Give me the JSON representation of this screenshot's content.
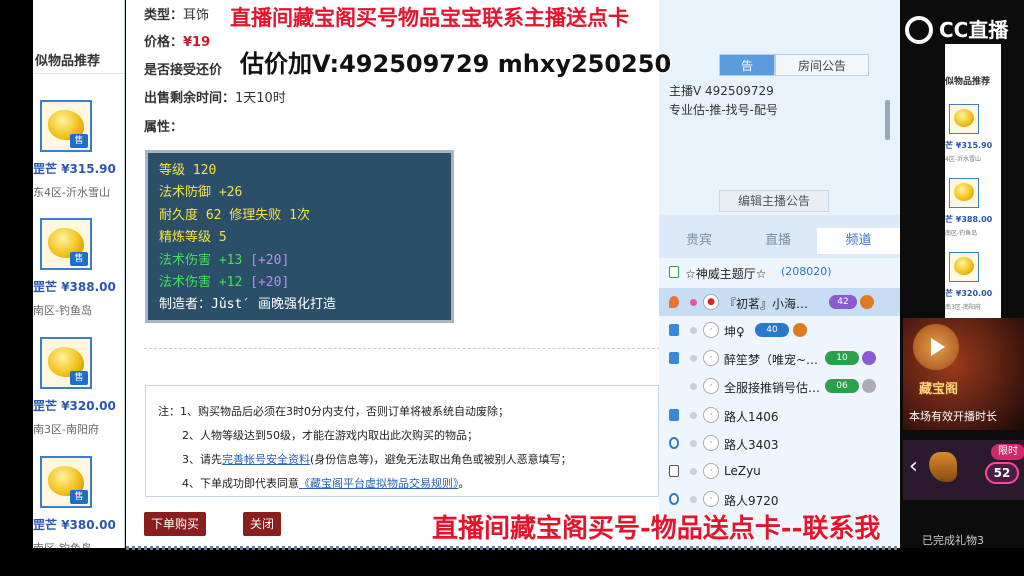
{
  "recommended": {
    "title": "似物品推荐",
    "sell_label": "售",
    "items": [
      {
        "prefix": "罡芒",
        "price": "¥315.90",
        "server": "东4区-沂水雪山"
      },
      {
        "prefix": "罡芒",
        "price": "¥388.00",
        "server": "南区-钓鱼岛"
      },
      {
        "prefix": "罡芒",
        "price": "¥320.00",
        "server": "南3区-南阳府"
      },
      {
        "prefix": "罡芒",
        "price": "¥380.00",
        "server": "南区-钓鱼岛"
      }
    ]
  },
  "detail": {
    "type_label": "类型：",
    "type_value": "耳饰",
    "price_label": "价格：",
    "price_value": "¥19",
    "accept_label": "是否接受还价",
    "remaining_label": "出售剩余时间：",
    "remaining_value": "1天10时",
    "attr_label": "属性：",
    "attributes": {
      "level": "等级 120",
      "magic_def": "法术防御 +26",
      "durability": "耐久度 62 修理失败 1次",
      "refine": "精炼等级 5",
      "magic_dmg1": "法术伤害 +13",
      "magic_dmg1_add": "[+20]",
      "magic_dmg2": "法术伤害 +12",
      "magic_dmg2_add": "[+20]",
      "maker": "制造者：Jǔst′ 画晚强化打造"
    },
    "notes": {
      "n1": "注：1、购买物品后必须在3时0分内支付，否则订单将被系统自动废除；",
      "n2": "2、人物等级达到50级，才能在游戏内取出此次购买的物品；",
      "n3_pre": "3、请先",
      "n3_link": "完善帐号安全资料",
      "n3_post": "(身份信息等)，避免无法取出角色或被别人恶意填写；",
      "n4_pre": "4、下单成功即代表同意",
      "n4_link": "《藏宝阁平台虚拟物品交易规则》",
      "n4_post": "。"
    },
    "buy_button": "下单购买",
    "close_button": "关闭"
  },
  "overlay": {
    "top": "直播间藏宝阁买号物品宝宝联系主播送点卡",
    "contact": "估价加V:492509729    mhxy250250",
    "bottom": "直播间藏宝阁买号-物品送点卡--联系我"
  },
  "chat": {
    "tab_announce": "告",
    "tab_room": "房间公告",
    "announce_line1": "主播V 492509729",
    "announce_line2": "专业估-推-找号-配号",
    "edit_button": "编辑主播公告",
    "tabs": [
      "贵宾",
      "直播",
      "频道"
    ],
    "channel_title": "☆神威主题厅☆",
    "channel_count": "(208020)",
    "users": [
      {
        "name": "『初茗』小海…",
        "badge": "42"
      },
      {
        "name": "坤♀",
        "badge": "40"
      },
      {
        "name": "醉笙梦（唯宠~…",
        "badge": "10"
      },
      {
        "name": "全服接推销号估…",
        "badge": "06"
      },
      {
        "name": "路人1406",
        "badge": ""
      },
      {
        "name": "路人3403",
        "badge": ""
      },
      {
        "name": "LeZyu",
        "badge": ""
      },
      {
        "name": "路人9720",
        "badge": ""
      }
    ]
  },
  "right": {
    "logo_text": "CC直播",
    "panel_title": "似物品推荐",
    "items": [
      {
        "price": "芒 ¥315.90",
        "server": "4区-沂水雪山"
      },
      {
        "price": "芒 ¥388.00",
        "server": "南区-钓鱼岛"
      },
      {
        "price": "芒 ¥320.00",
        "server": "南3区-南阳府"
      }
    ],
    "promo_title": "藏宝阁",
    "promo_sub": "本场有效开播时长",
    "limit_label": "限时",
    "count": "52",
    "bottom_text": "已完成礼物3"
  },
  "colors": {
    "accent": "#3c7dc9",
    "price": "#c7192a",
    "overlay": "#e3152d",
    "attr_bg": "#2b4f68"
  }
}
